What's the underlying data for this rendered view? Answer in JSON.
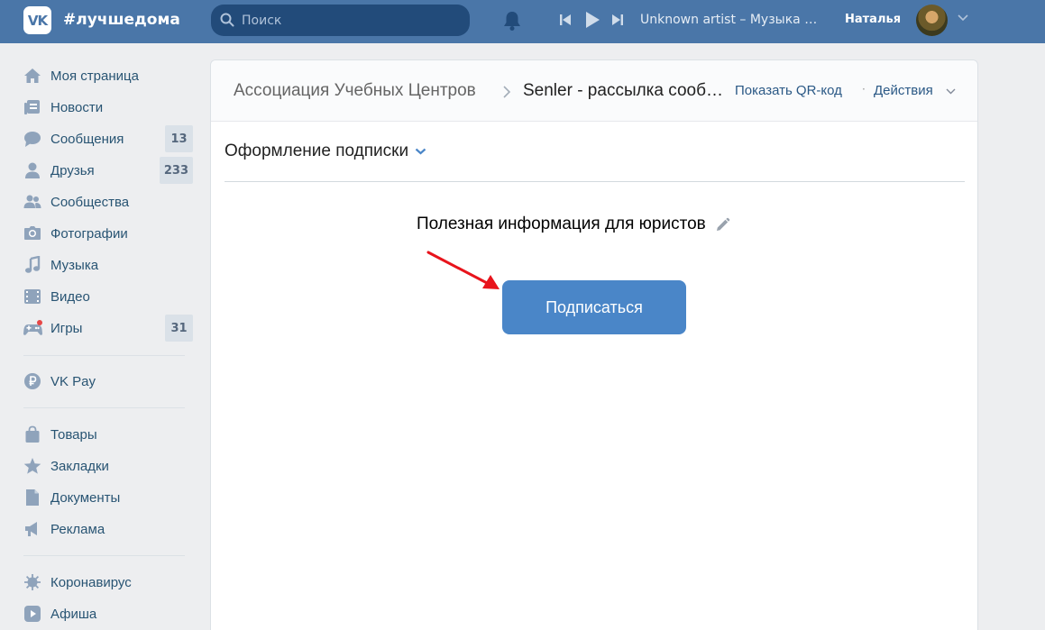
{
  "topbar": {
    "logo_text": "VK",
    "hashtag": "#лучшедома",
    "search_placeholder": "Поиск",
    "track": "Unknown artist – Музыка Интро",
    "user_name": "Наталья"
  },
  "sidebar": {
    "items": [
      {
        "label": "Моя страница",
        "icon": "home-icon"
      },
      {
        "label": "Новости",
        "icon": "news-icon"
      },
      {
        "label": "Сообщения",
        "icon": "messages-icon",
        "count": "13"
      },
      {
        "label": "Друзья",
        "icon": "friends-icon",
        "count": "233"
      },
      {
        "label": "Сообщества",
        "icon": "communities-icon"
      },
      {
        "label": "Фотографии",
        "icon": "camera-icon"
      },
      {
        "label": "Музыка",
        "icon": "music-note-icon"
      },
      {
        "label": "Видео",
        "icon": "film-icon"
      },
      {
        "label": "Игры",
        "icon": "gamepad-icon",
        "count": "31"
      },
      {
        "label": "VK Pay",
        "icon": "ruble-coin-icon"
      },
      {
        "label": "Товары",
        "icon": "shopping-bag-icon"
      },
      {
        "label": "Закладки",
        "icon": "star-icon"
      },
      {
        "label": "Документы",
        "icon": "document-icon"
      },
      {
        "label": "Реклама",
        "icon": "megaphone-icon"
      },
      {
        "label": "Коронавирус",
        "icon": "virus-icon"
      },
      {
        "label": "Афиша",
        "icon": "play-square-icon"
      }
    ]
  },
  "main": {
    "breadcrumb_1": "Ассоциация Учебных Центров",
    "breadcrumb_2": "Senler - рассылка сообщений",
    "qr_label": "Показать QR-код",
    "separator_dot": "·",
    "actions_label": "Действия",
    "section_title": "Оформление подписки",
    "widget_title": "Полезная информация для юристов",
    "subscribe_label": "Подписаться"
  },
  "colors": {
    "topbar": "#4a76a8",
    "accent_button": "#4a86c8",
    "link": "#2a5885",
    "annotation_arrow": "#e8141c"
  }
}
